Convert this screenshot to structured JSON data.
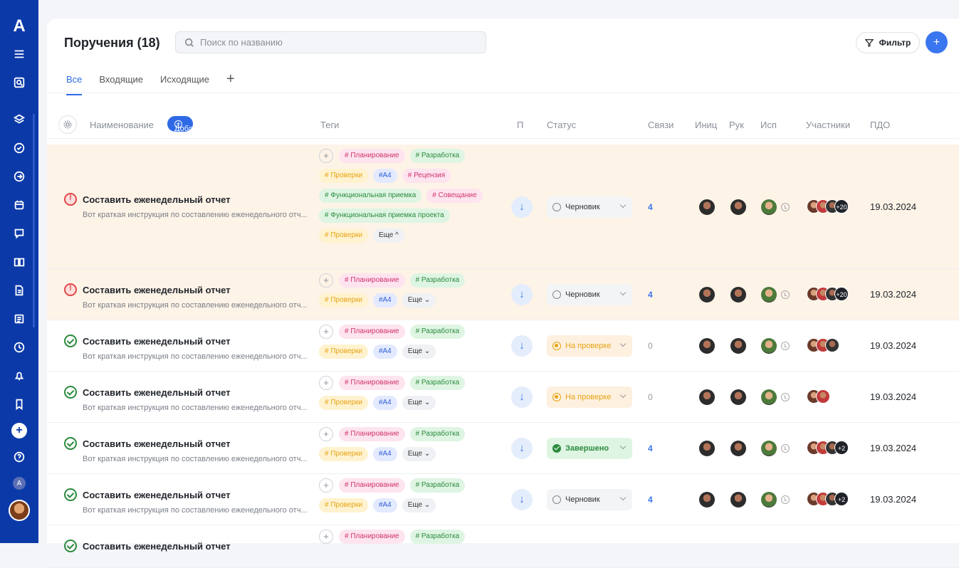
{
  "sidebar": {
    "logo": "A",
    "avatar_letter": "A"
  },
  "header": {
    "title": "Поручения (18)",
    "search_placeholder": "Поиск по названию",
    "filter_label": "Фильтр",
    "add_icon": "plus-icon"
  },
  "tabs": [
    {
      "label": "Все",
      "active": true
    },
    {
      "label": "Входящие",
      "active": false
    },
    {
      "label": "Исходящие",
      "active": false
    }
  ],
  "table": {
    "columns": {
      "name": "Наименование",
      "add": "Добавить",
      "tags": "Теги",
      "p": "П",
      "status": "Статус",
      "links": "Связи",
      "init": "Иниц",
      "head": "Рук",
      "exec": "Исп",
      "participants": "Участники",
      "pdo": "ПДО"
    },
    "rows": [
      {
        "icon": "warning",
        "name": "Составить еженедельный отчет",
        "desc": "Вот краткая инструкция по составлению еженедельного отч...",
        "tags": [
          {
            "text": "# Планирование",
            "color": "pink"
          },
          {
            "text": "# Разработка",
            "color": "green"
          },
          {
            "text": "# Проверки",
            "color": "yellow"
          },
          {
            "text": "#A4",
            "color": "blue"
          },
          {
            "text": "# Рецензия",
            "color": "pink"
          },
          {
            "text": "# Функциональная приемка",
            "color": "green"
          },
          {
            "text": "# Совещание",
            "color": "pink"
          },
          {
            "text": "# Функциональная приемка проекта",
            "color": "green"
          },
          {
            "text": "# Проверки",
            "color": "yellow"
          },
          {
            "text": "Еще ^",
            "color": "gray"
          }
        ],
        "status": "Черновик",
        "status_type": "draft",
        "links": "4",
        "participants_more": "+20",
        "date": "19.03.2024"
      },
      {
        "icon": "warning",
        "name": "Составить еженедельный отчет",
        "desc": "Вот краткая инструкция по составлению еженедельного отч...",
        "tags": [
          {
            "text": "# Планирование",
            "color": "pink"
          },
          {
            "text": "# Разработка",
            "color": "green"
          },
          {
            "text": "# Проверки",
            "color": "yellow"
          },
          {
            "text": "#A4",
            "color": "blue"
          },
          {
            "text": "Еще ⌄",
            "color": "gray"
          }
        ],
        "status": "Черновик",
        "status_type": "draft",
        "links": "4",
        "participants_more": "+20",
        "date": "19.03.2024"
      },
      {
        "icon": "ok",
        "name": "Составить еженедельный отчет",
        "desc": "Вот краткая инструкция по составлению еженедельного отч...",
        "tags": [
          {
            "text": "# Планирование",
            "color": "pink"
          },
          {
            "text": "# Разработка",
            "color": "green"
          },
          {
            "text": "# Проверки",
            "color": "yellow"
          },
          {
            "text": "#A4",
            "color": "blue"
          },
          {
            "text": "Еще ⌄",
            "color": "gray"
          }
        ],
        "status": "На проверке",
        "status_type": "review",
        "links": "0",
        "participants_more": "",
        "date": "19.03.2024"
      },
      {
        "icon": "ok",
        "name": "Составить еженедельный отчет",
        "desc": "Вот краткая инструкция по составлению еженедельного отч...",
        "tags": [
          {
            "text": "# Планирование",
            "color": "pink"
          },
          {
            "text": "# Разработка",
            "color": "green"
          },
          {
            "text": "# Проверки",
            "color": "yellow"
          },
          {
            "text": "#A4",
            "color": "blue"
          },
          {
            "text": "Еще ⌄",
            "color": "gray"
          }
        ],
        "status": "На проверке",
        "status_type": "review",
        "links": "0",
        "participants_more": "",
        "date": "19.03.2024"
      },
      {
        "icon": "ok",
        "name": "Составить еженедельный отчет",
        "desc": "Вот краткая инструкция по составлению еженедельного отч...",
        "tags": [
          {
            "text": "# Планирование",
            "color": "pink"
          },
          {
            "text": "# Разработка",
            "color": "green"
          },
          {
            "text": "# Проверки",
            "color": "yellow"
          },
          {
            "text": "#A4",
            "color": "blue"
          },
          {
            "text": "Еще ⌄",
            "color": "gray"
          }
        ],
        "status": "Завершено",
        "status_type": "done",
        "links": "4",
        "participants_more": "+2",
        "date": "19.03.2024"
      },
      {
        "icon": "ok",
        "name": "Составить еженедельный отчет",
        "desc": "Вот краткая инструкция по составлению еженедельного отч...",
        "tags": [
          {
            "text": "# Планирование",
            "color": "pink"
          },
          {
            "text": "# Разработка",
            "color": "green"
          },
          {
            "text": "# Проверки",
            "color": "yellow"
          },
          {
            "text": "#A4",
            "color": "blue"
          },
          {
            "text": "Еще ⌄",
            "color": "gray"
          }
        ],
        "status": "Черновик",
        "status_type": "draft",
        "links": "4",
        "participants_more": "+2",
        "date": "19.03.2024"
      },
      {
        "icon": "ok",
        "name": "Составить еженедельный отчет",
        "desc": "",
        "tags": [
          {
            "text": "# Планирование",
            "color": "pink"
          },
          {
            "text": "# Разработка",
            "color": "green"
          }
        ],
        "status": "",
        "status_type": "none",
        "links": "",
        "participants_more": "",
        "date": ""
      }
    ]
  },
  "colors": {
    "sidebar": "#0b3aa8",
    "accent": "#2f6ae6",
    "highlight_row": "#fdf3e7"
  }
}
